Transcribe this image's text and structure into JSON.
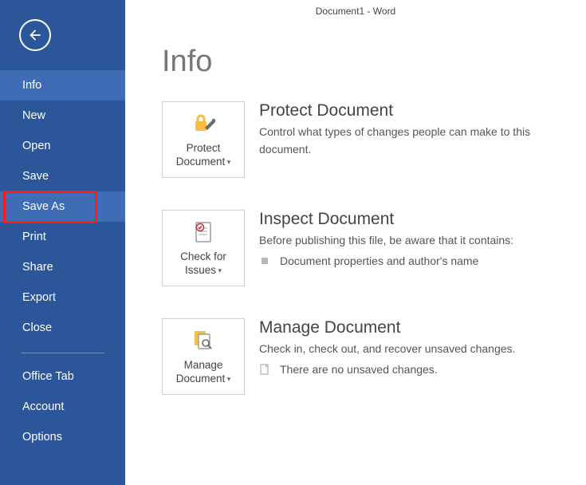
{
  "window": {
    "title": "Document1 - Word"
  },
  "sidebar": {
    "items": [
      {
        "label": "Info",
        "state": "selected"
      },
      {
        "label": "New"
      },
      {
        "label": "Open"
      },
      {
        "label": "Save"
      },
      {
        "label": "Save As",
        "state": "highlighted"
      },
      {
        "label": "Print"
      },
      {
        "label": "Share"
      },
      {
        "label": "Export"
      },
      {
        "label": "Close"
      }
    ],
    "footer_items": [
      {
        "label": "Office Tab"
      },
      {
        "label": "Account"
      },
      {
        "label": "Options"
      }
    ]
  },
  "page": {
    "title": "Info",
    "sections": [
      {
        "tile_label": "Protect Document",
        "heading": "Protect Document",
        "desc": "Control what types of changes people can make to this document."
      },
      {
        "tile_label": "Check for Issues",
        "heading": "Inspect Document",
        "desc": "Before publishing this file, be aware that it contains:",
        "bullet": "Document properties and author's name"
      },
      {
        "tile_label": "Manage Document",
        "heading": "Manage Document",
        "desc": "Check in, check out, and recover unsaved changes.",
        "bullet": "There are no unsaved changes."
      }
    ]
  }
}
